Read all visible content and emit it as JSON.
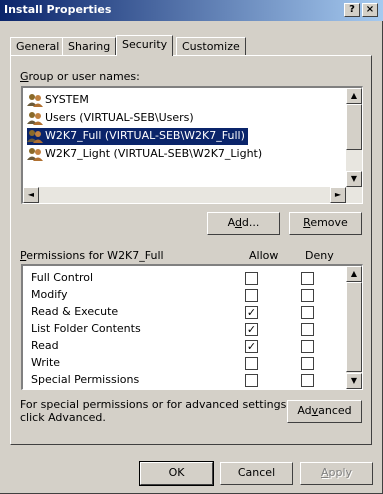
{
  "window": {
    "title": "Install Properties",
    "help_glyph": "?",
    "close_glyph": "×"
  },
  "tabs": [
    {
      "label": "General"
    },
    {
      "label": "Sharing"
    },
    {
      "label": "Security"
    },
    {
      "label": "Customize"
    }
  ],
  "users_section": {
    "label_prefix": "G",
    "label_rest": "roup or user names:",
    "items": [
      {
        "name": "SYSTEM"
      },
      {
        "name": "Users (VIRTUAL-SEB\\Users)"
      },
      {
        "name": "W2K7_Full (VIRTUAL-SEB\\W2K7_Full)"
      },
      {
        "name": "W2K7_Light (VIRTUAL-SEB\\W2K7_Light)"
      }
    ],
    "selected_index": 2
  },
  "buttons": {
    "add_pre": "A",
    "add_ul": "d",
    "add_post": "d...",
    "remove_ul": "R",
    "remove_post": "emove",
    "advanced_pre": "Ad",
    "advanced_ul": "v",
    "advanced_post": "anced",
    "ok": "OK",
    "cancel": "Cancel",
    "apply_ul": "A",
    "apply_post": "pply"
  },
  "permissions": {
    "label_prefix": "P",
    "label_rest": "ermissions for W2K7_Full",
    "allow_header": "Allow",
    "deny_header": "Deny",
    "check_glyph": "✓",
    "rows": [
      {
        "name": "Full Control",
        "allow": false,
        "deny": false
      },
      {
        "name": "Modify",
        "allow": false,
        "deny": false
      },
      {
        "name": "Read & Execute",
        "allow": true,
        "deny": false
      },
      {
        "name": "List Folder Contents",
        "allow": true,
        "deny": false
      },
      {
        "name": "Read",
        "allow": true,
        "deny": false
      },
      {
        "name": "Write",
        "allow": false,
        "deny": false
      },
      {
        "name": "Special Permissions",
        "allow": false,
        "deny": false
      }
    ]
  },
  "advanced_note": {
    "line1": "For special permissions or for advanced settings,",
    "line2": "click Advanced."
  },
  "scroll": {
    "up": "▲",
    "down": "▼",
    "left": "◄",
    "right": "►"
  },
  "colors": {
    "selection": "#0a246a",
    "face": "#d4d0c8"
  }
}
